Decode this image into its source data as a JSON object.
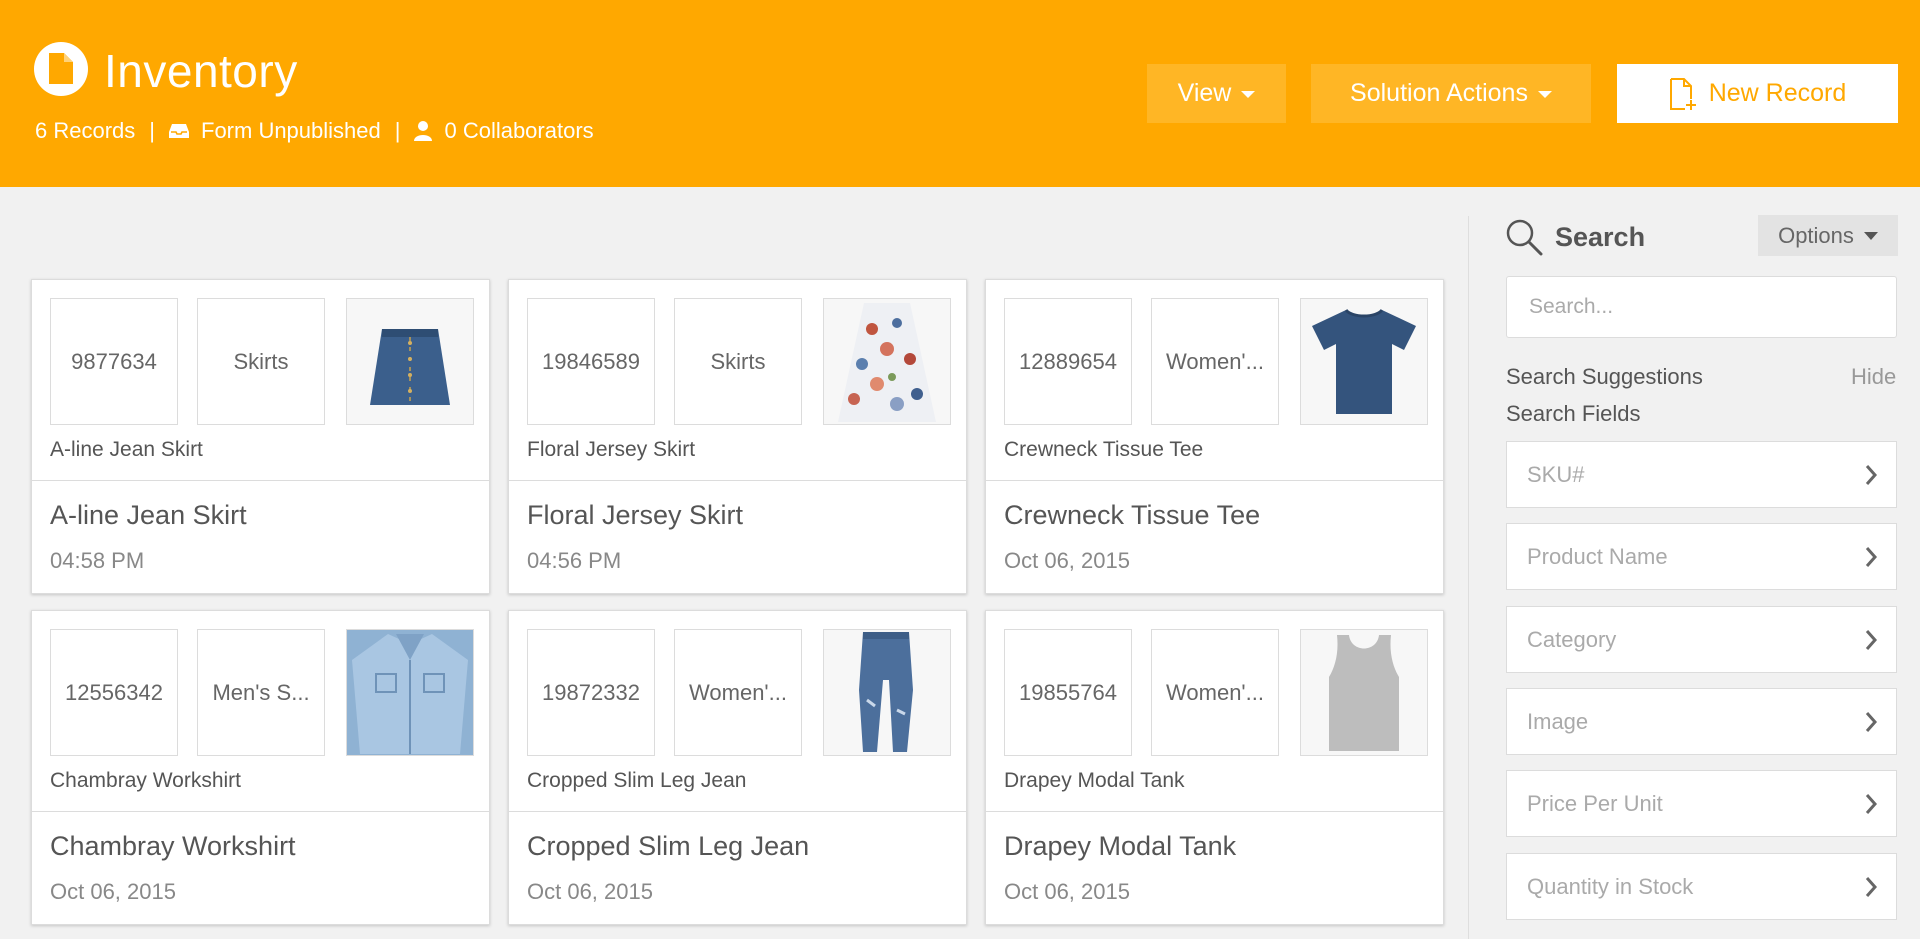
{
  "header": {
    "title": "Inventory",
    "records": "6 Records",
    "separator": "|",
    "form_status": "Form Unpublished",
    "collaborators": "0 Collaborators",
    "view_label": "View",
    "solution_actions_label": "Solution Actions",
    "new_record_label": "New Record"
  },
  "colors": {
    "accent": "#ffa800",
    "accent_light": "#ffb625"
  },
  "cards": [
    {
      "sku": "9877634",
      "category": "Skirts",
      "subtitle": "A-line Jean Skirt",
      "title": "A-line Jean Skirt",
      "date": "04:58 PM",
      "image": "denim-skirt-icon"
    },
    {
      "sku": "19846589",
      "category": "Skirts",
      "subtitle": "Floral Jersey Skirt",
      "title": "Floral Jersey Skirt",
      "date": "04:56 PM",
      "image": "floral-skirt-icon"
    },
    {
      "sku": "12889654",
      "category": "Women'...",
      "subtitle": "Crewneck Tissue Tee",
      "title": "Crewneck Tissue Tee",
      "date": "Oct 06, 2015",
      "image": "tshirt-icon"
    },
    {
      "sku": "12556342",
      "category": "Men's S...",
      "subtitle": "Chambray Workshirt",
      "title": "Chambray Workshirt",
      "date": "Oct 06, 2015",
      "image": "shirt-icon"
    },
    {
      "sku": "19872332",
      "category": "Women'...",
      "subtitle": "Cropped Slim Leg Jean",
      "title": "Cropped Slim Leg Jean",
      "date": "Oct 06, 2015",
      "image": "jeans-icon"
    },
    {
      "sku": "19855764",
      "category": "Women'...",
      "subtitle": "Drapey Modal Tank",
      "title": "Drapey Modal Tank",
      "date": "Oct 06, 2015",
      "image": "tank-top-icon"
    }
  ],
  "sidebar": {
    "search_label": "Search",
    "options_label": "Options",
    "search_placeholder": "Search...",
    "suggestions_label": "Search Suggestions",
    "hide_label": "Hide",
    "fields_label": "Search Fields",
    "fields": [
      "SKU#",
      "Product Name",
      "Category",
      "Image",
      "Price Per Unit",
      "Quantity in Stock"
    ]
  }
}
